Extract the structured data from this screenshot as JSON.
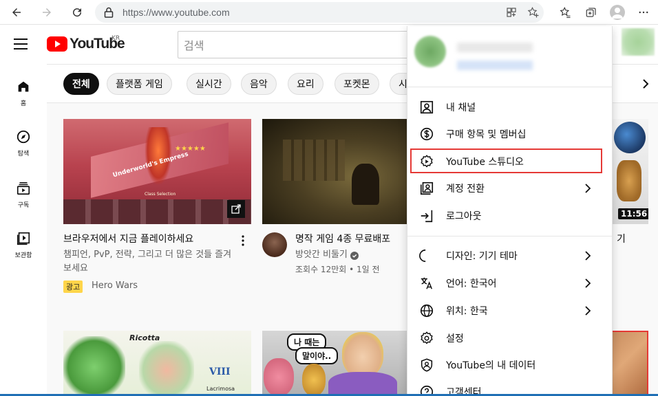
{
  "browser": {
    "url": "https://www.youtube.com"
  },
  "header": {
    "logo_text": "YouTube",
    "region": "KR",
    "search_placeholder": "검색"
  },
  "sidebar": {
    "items": [
      {
        "label": "홈",
        "icon": "home-icon"
      },
      {
        "label": "탐색",
        "icon": "compass-icon"
      },
      {
        "label": "구독",
        "icon": "subscriptions-icon"
      },
      {
        "label": "보관함",
        "icon": "library-icon"
      }
    ]
  },
  "chips": [
    "전체",
    "플랫폼 게임",
    "실시간",
    "음악",
    "요리",
    "포켓몬",
    "시"
  ],
  "videos": [
    {
      "title": "브라우저에서 지금 플레이하세요",
      "desc_line1": "챔피언, PvP, 전략, 그리고 더 많은 것들 즐겨",
      "desc_line2": "보세요",
      "ad_badge": "광고",
      "advertiser": "Hero Wars",
      "thumb_text": "Underworld's Empress",
      "thumb_sub": "Class Selection"
    },
    {
      "title": "명작 게임 4종 무료배포",
      "channel": "방앗간 비둘기",
      "meta": "조회수 12만회 • 1일 전"
    },
    {
      "duration": "11:56",
      "title_partial": "기"
    },
    {
      "thumb_text": "Ricotta",
      "thumb_sub": "Lacrimosa",
      "thumb_mark": "VIII"
    },
    {
      "thumb_text_1": "나 때는",
      "thumb_text_2": "말이야.."
    }
  ],
  "menu": {
    "items": [
      {
        "label": "내 채널",
        "icon": "account-box-icon",
        "chevron": false
      },
      {
        "label": "구매 항목 및 멤버십",
        "icon": "dollar-icon",
        "chevron": false
      },
      {
        "label": "YouTube 스튜디오",
        "icon": "studio-gear-icon",
        "chevron": false
      },
      {
        "label": "계정 전환",
        "icon": "switch-account-icon",
        "chevron": true
      },
      {
        "label": "로그아웃",
        "icon": "sign-out-icon",
        "chevron": false
      },
      {
        "label": "디자인: 기기 테마",
        "icon": "moon-icon",
        "chevron": true
      },
      {
        "label": "언어: 한국어",
        "icon": "translate-icon",
        "chevron": true
      },
      {
        "label": "위치: 한국",
        "icon": "globe-icon",
        "chevron": true
      },
      {
        "label": "설정",
        "icon": "gear-icon",
        "chevron": false
      },
      {
        "label": "YouTube의 내 데이터",
        "icon": "shield-person-icon",
        "chevron": false
      },
      {
        "label": "고객센터",
        "icon": "help-icon",
        "chevron": false
      }
    ]
  },
  "colors": {
    "youtube_red": "#ff0000",
    "highlight": "#e53935",
    "ad_yellow": "#ffd54a"
  }
}
